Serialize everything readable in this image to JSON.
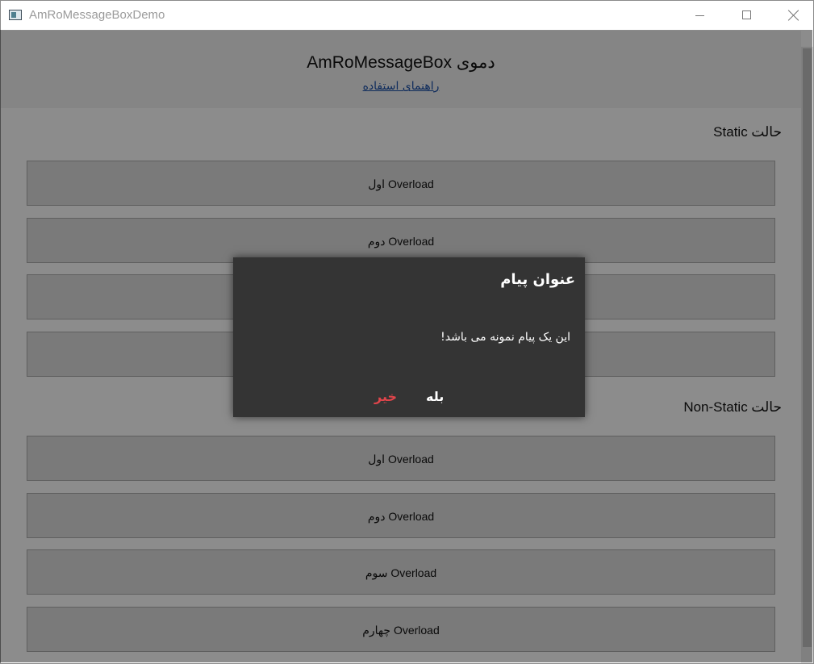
{
  "window": {
    "title": "AmRoMessageBoxDemo",
    "icon": "app-window-icon",
    "controls": {
      "minimize": "minimize-icon",
      "maximize": "maximize-icon",
      "close": "close-icon"
    }
  },
  "header": {
    "title": "دموی AmRoMessageBox",
    "help_link": "راهنمای استفاده"
  },
  "sections": {
    "static": {
      "title": "حالت Static",
      "buttons": [
        "Overload اول",
        "Overload دوم",
        "",
        ""
      ]
    },
    "non_static": {
      "title": "حالت Non-Static",
      "buttons": [
        "Overload اول",
        "Overload دوم",
        "Overload سوم",
        "Overload چهارم"
      ]
    }
  },
  "dialog": {
    "title": "عنوان پیام",
    "message": "این یک پیام نمونه می باشد!",
    "yes_label": "بله",
    "no_label": "خیر"
  },
  "colors": {
    "dialog_bg": "#343434",
    "no_button": "#e0454b",
    "link": "#1a4fa8",
    "overlay": "rgba(0,0,0,0.45)"
  }
}
